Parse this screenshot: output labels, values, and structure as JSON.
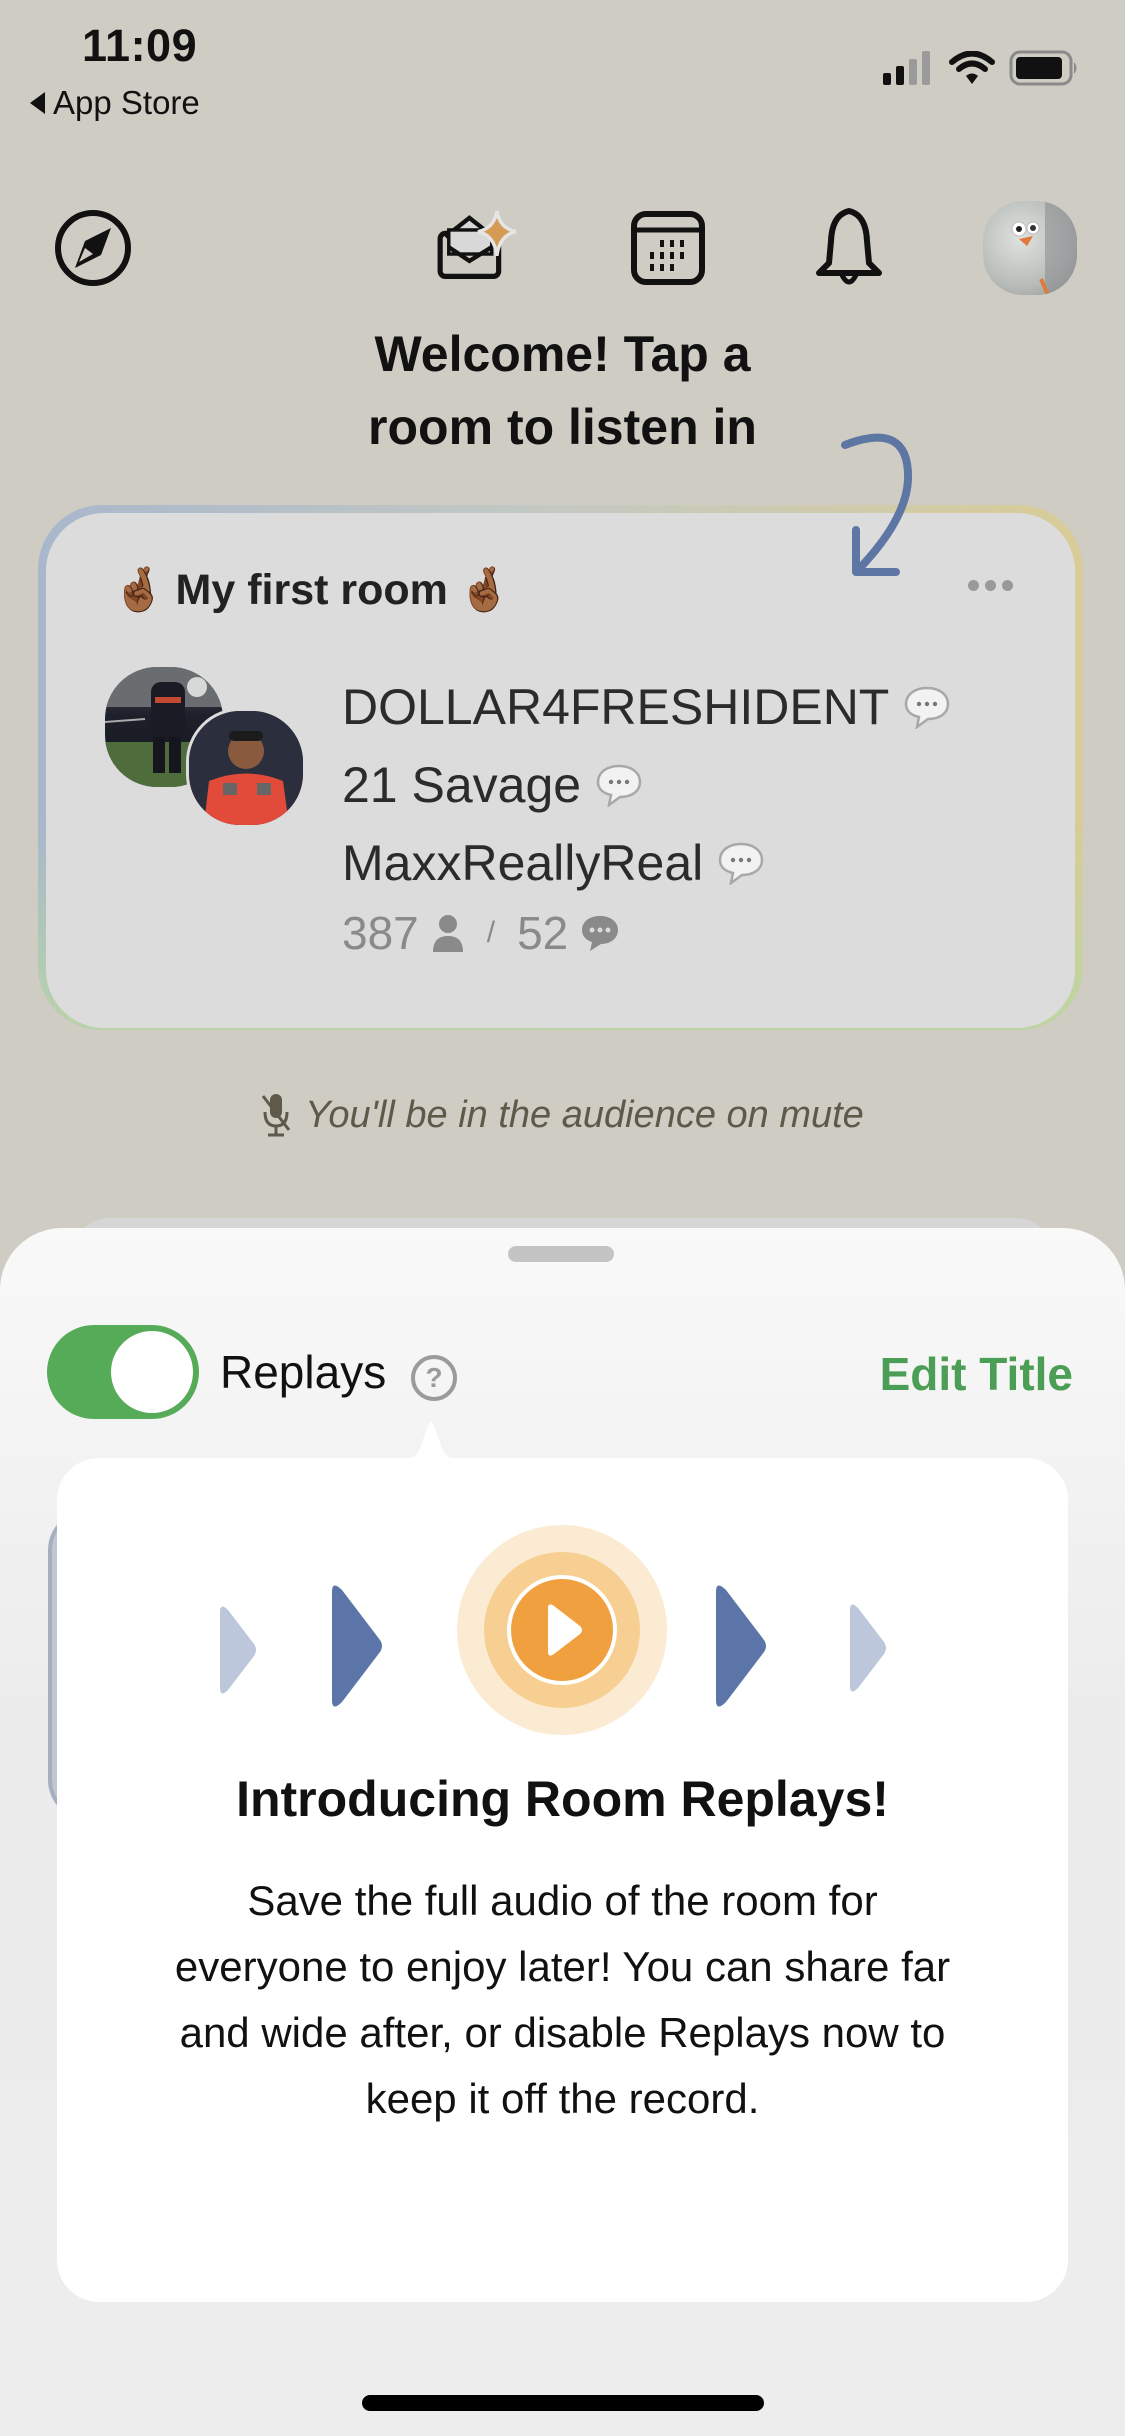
{
  "status_bar": {
    "time": "11:09",
    "back_label": "App Store",
    "signal_bars_active": 2,
    "signal_bars_total": 4,
    "battery_level": 0.8
  },
  "header": {
    "icons": [
      "compass-icon",
      "invite-envelope-sparkle-icon",
      "calendar-icon",
      "bell-icon",
      "profile-avatar"
    ]
  },
  "welcome": {
    "line1": "Welcome! Tap a",
    "line2": "room to listen in"
  },
  "room": {
    "emoji": "🤞🏾",
    "title": "My first room",
    "speakers": [
      {
        "name": "DOLLAR4FRESHIDENT"
      },
      {
        "name": "21 Savage"
      },
      {
        "name": "MaxxReallyReal"
      }
    ],
    "listener_count": "387",
    "separator": "/",
    "speaker_count": "52"
  },
  "mute_note": "You'll be in the audience on mute",
  "sheet": {
    "replays_label": "Replays",
    "replays_enabled": true,
    "help_label": "?",
    "edit_title_label": "Edit Title"
  },
  "popover": {
    "title": "Introducing Room Replays!",
    "body": "Save the full audio of the room for everyone to enjoy later! You can share far and wide after, or disable Replays now to keep it off the record."
  },
  "colors": {
    "accent_green": "#4c9e56",
    "toggle_green": "#55ab57",
    "replay_orange": "#f0a03e",
    "arrow_blue": "#5e76a3"
  }
}
